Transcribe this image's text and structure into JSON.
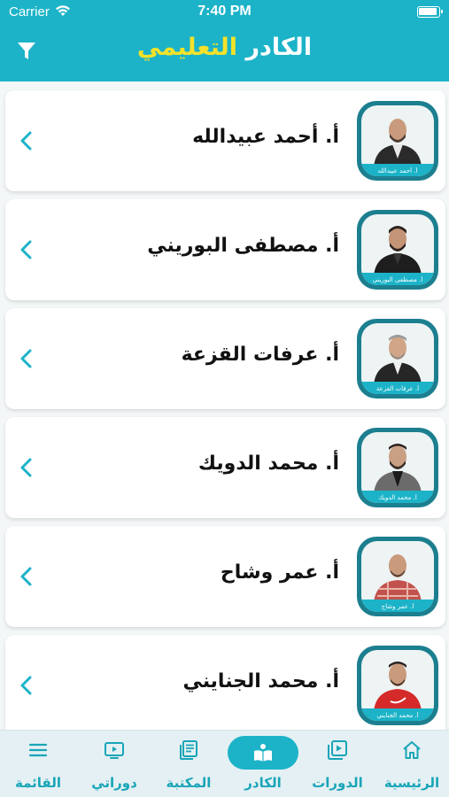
{
  "status": {
    "carrier": "Carrier",
    "time": "7:40 PM"
  },
  "header": {
    "title_part1": "الكادر",
    "title_part2": "التعليمي",
    "filter_icon": "filter-icon"
  },
  "colors": {
    "primary": "#1cb3c8",
    "accent": "#f4e22a",
    "dark_teal": "#1c7f8f"
  },
  "teachers": [
    {
      "name": "أ. أحمد عبيدالله",
      "caption": "أ. أحمد عبيدالله"
    },
    {
      "name": "أ. مصطفى البوريني",
      "caption": "أ. مصطفى البوريني"
    },
    {
      "name": "أ. عرفات القزعة",
      "caption": "أ. عرفات القزعة"
    },
    {
      "name": "أ. محمد الدويك",
      "caption": "أ. محمد الدويك"
    },
    {
      "name": "أ. عمر وشاح",
      "caption": "أ. عمر وشاح"
    },
    {
      "name": "أ. محمد الجنايني",
      "caption": "أ. محمد الجنايني"
    }
  ],
  "tabs": [
    {
      "label": "الرئيسية",
      "icon": "home-icon"
    },
    {
      "label": "الدورات",
      "icon": "play-library-icon"
    },
    {
      "label": "الكادر",
      "icon": "teacher-icon",
      "active": true
    },
    {
      "label": "المكتبة",
      "icon": "document-icon"
    },
    {
      "label": "دوراتي",
      "icon": "tv-icon"
    },
    {
      "label": "القائمة",
      "icon": "menu-icon"
    }
  ]
}
